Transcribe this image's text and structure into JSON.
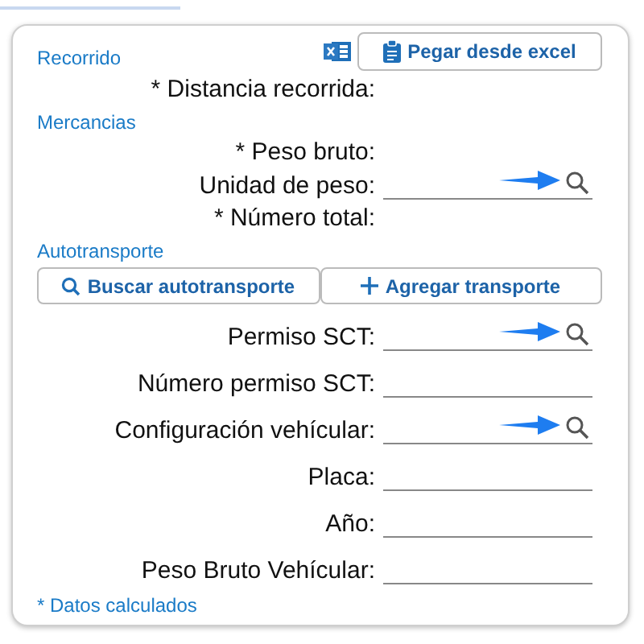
{
  "excel_button": {
    "label": "Pegar desde excel"
  },
  "sections": [
    {
      "title": "Recorrido",
      "rows": [
        {
          "label": "* Distancia recorrida:",
          "kind": "calc"
        }
      ]
    },
    {
      "title": "Mercancias",
      "rows": [
        {
          "label": "* Peso bruto:",
          "kind": "calc"
        },
        {
          "label": "Unidad de peso:",
          "kind": "lookup",
          "pointed": true
        },
        {
          "label": "* Número total:",
          "kind": "calc"
        }
      ]
    },
    {
      "title": "Autotransporte",
      "buttons": [
        {
          "label": "Buscar autotransporte",
          "kind": "search"
        },
        {
          "label": "Agregar transporte",
          "kind": "add"
        }
      ],
      "rows": [
        {
          "label": "Permiso SCT:",
          "kind": "lookup",
          "pointed": true
        },
        {
          "label": "Número permiso SCT:",
          "kind": "text"
        },
        {
          "label": "Configuración vehícular:",
          "kind": "lookup",
          "pointed": true
        },
        {
          "label": "Placa:",
          "kind": "text"
        },
        {
          "label": "Año:",
          "kind": "text"
        },
        {
          "label": "Peso Bruto Vehícular:",
          "kind": "text"
        }
      ]
    }
  ],
  "footnote": "* Datos calculados"
}
